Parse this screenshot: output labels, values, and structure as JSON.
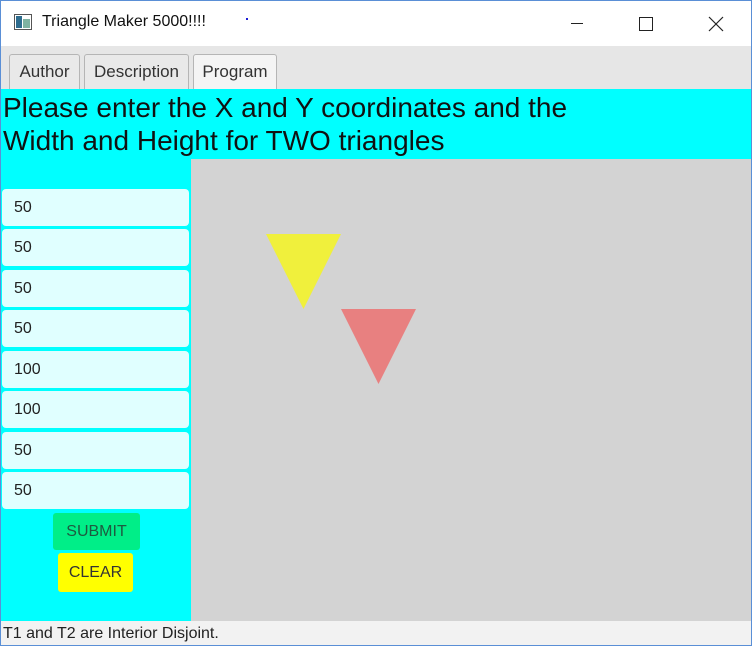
{
  "window": {
    "title": "Triangle Maker 5000!!!!"
  },
  "tabs": [
    {
      "label": "Author"
    },
    {
      "label": "Description"
    },
    {
      "label": "Program"
    }
  ],
  "header": {
    "text": "Please enter the X and Y coordinates and the Width and Height for TWO triangles"
  },
  "inputs": {
    "values": [
      "50",
      "50",
      "50",
      "50",
      "100",
      "100",
      "50",
      "50"
    ]
  },
  "buttons": {
    "submit_label": "SUBMIT",
    "clear_label": "CLEAR"
  },
  "status": {
    "text": "T1 and T2 are Interior Disjoint."
  },
  "colors": {
    "accent": "#00ffff",
    "field_background": "#e0ffff",
    "canvas_background": "#d3d3d3",
    "submit_button": "#00ee88",
    "clear_button": "#ffff00",
    "triangle_1": "#f0f03c",
    "triangle_2": "#e88080"
  }
}
